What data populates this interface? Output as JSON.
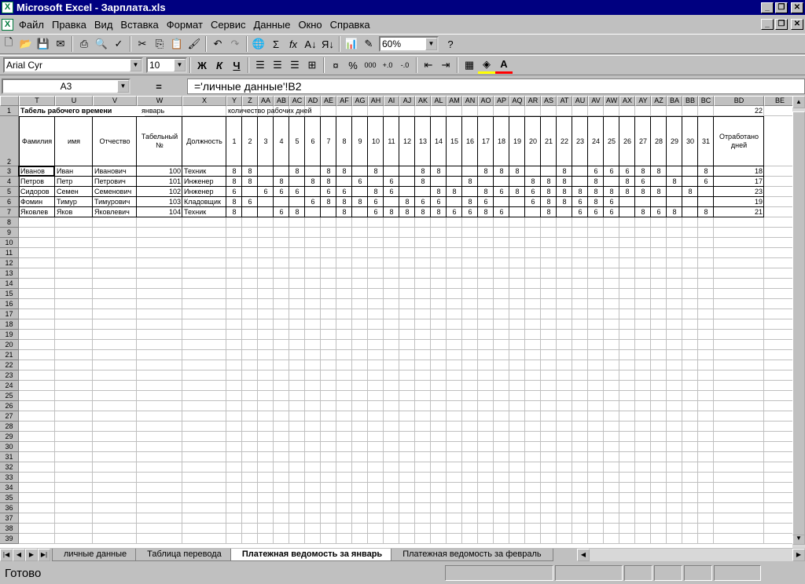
{
  "app_title": "Microsoft Excel - Зарплата.xls",
  "menus": [
    "Файл",
    "Правка",
    "Вид",
    "Вставка",
    "Формат",
    "Сервис",
    "Данные",
    "Окно",
    "Справка"
  ],
  "zoom": "60%",
  "font_name": "Arial Cyr",
  "font_size": "10",
  "name_box": "A3",
  "equals": "=",
  "formula": "='личные данные'!B2",
  "format_buttons": {
    "bold": "Ж",
    "italic": "К",
    "underline": "Ч"
  },
  "columns": [
    {
      "id": "T",
      "w": 46
    },
    {
      "id": "U",
      "w": 48
    },
    {
      "id": "V",
      "w": 56
    },
    {
      "id": "W",
      "w": 58
    },
    {
      "id": "X",
      "w": 56
    },
    {
      "id": "Y",
      "w": 20
    },
    {
      "id": "Z",
      "w": 20
    },
    {
      "id": "AA",
      "w": 20
    },
    {
      "id": "AB",
      "w": 20
    },
    {
      "id": "AC",
      "w": 20
    },
    {
      "id": "AD",
      "w": 20
    },
    {
      "id": "AE",
      "w": 20
    },
    {
      "id": "AF",
      "w": 20
    },
    {
      "id": "AG",
      "w": 20
    },
    {
      "id": "AH",
      "w": 20
    },
    {
      "id": "AI",
      "w": 20
    },
    {
      "id": "AJ",
      "w": 20
    },
    {
      "id": "AK",
      "w": 20
    },
    {
      "id": "AL",
      "w": 20
    },
    {
      "id": "AM",
      "w": 20
    },
    {
      "id": "AN",
      "w": 20
    },
    {
      "id": "AO",
      "w": 20
    },
    {
      "id": "AP",
      "w": 20
    },
    {
      "id": "AQ",
      "w": 20
    },
    {
      "id": "AR",
      "w": 20
    },
    {
      "id": "AS",
      "w": 20
    },
    {
      "id": "AT",
      "w": 20
    },
    {
      "id": "AU",
      "w": 20
    },
    {
      "id": "AV",
      "w": 20
    },
    {
      "id": "AW",
      "w": 20
    },
    {
      "id": "AX",
      "w": 20
    },
    {
      "id": "AY",
      "w": 20
    },
    {
      "id": "AZ",
      "w": 20
    },
    {
      "id": "BA",
      "w": 20
    },
    {
      "id": "BB",
      "w": 20
    },
    {
      "id": "BC",
      "w": 20
    },
    {
      "id": "BD",
      "w": 64
    },
    {
      "id": "BE",
      "w": 40
    }
  ],
  "row1": {
    "title": "Табель рабочего времени",
    "month": "январь",
    "days_label": "количество рабочих дней",
    "days_total": "22"
  },
  "headers": [
    "Фамилия",
    "имя",
    "Отчество",
    "Табельный №",
    "Должность"
  ],
  "day_numbers": [
    "1",
    "2",
    "3",
    "4",
    "5",
    "6",
    "7",
    "8",
    "9",
    "10",
    "11",
    "12",
    "13",
    "14",
    "15",
    "16",
    "17",
    "18",
    "19",
    "20",
    "21",
    "22",
    "23",
    "24",
    "25",
    "26",
    "27",
    "28",
    "29",
    "30",
    "31"
  ],
  "worked_header": "Отработано дней",
  "employees": [
    {
      "last": "Иванов",
      "first": "Иван",
      "middle": "Иванович",
      "num": "100",
      "pos": "Техник",
      "days": [
        "8",
        "8",
        "",
        "",
        "8",
        "",
        "8",
        "8",
        "",
        "8",
        "",
        "",
        "8",
        "8",
        "",
        "",
        "8",
        "8",
        "8",
        "",
        "",
        "8",
        "",
        "6",
        "6",
        "6",
        "8",
        "8",
        "",
        "",
        "8"
      ],
      "total": "18"
    },
    {
      "last": "Петров",
      "first": "Петр",
      "middle": "Петрович",
      "num": "101",
      "pos": "Инженер",
      "days": [
        "8",
        "8",
        "",
        "8",
        "",
        "8",
        "8",
        "",
        "6",
        "",
        "6",
        "",
        "8",
        "",
        "",
        "8",
        "",
        "",
        "",
        "8",
        "8",
        "8",
        "",
        "8",
        "",
        "8",
        "6",
        "",
        "8",
        "",
        "6"
      ],
      "total": "17"
    },
    {
      "last": "Сидоров",
      "first": "Семен",
      "middle": "Семенович",
      "num": "102",
      "pos": "Инженер",
      "days": [
        "6",
        "",
        "6",
        "6",
        "6",
        "",
        "6",
        "6",
        "",
        "8",
        "6",
        "",
        "",
        "8",
        "8",
        "",
        "8",
        "6",
        "8",
        "6",
        "8",
        "8",
        "8",
        "8",
        "8",
        "8",
        "8",
        "8",
        "",
        "8",
        ""
      ],
      "total": "23"
    },
    {
      "last": "Фомин",
      "first": "Тимур",
      "middle": "Тимурович",
      "num": "103",
      "pos": "Кладовщик",
      "days": [
        "8",
        "6",
        "",
        "",
        "",
        "6",
        "8",
        "8",
        "8",
        "6",
        "",
        "8",
        "6",
        "6",
        "",
        "8",
        "6",
        "",
        "",
        "6",
        "8",
        "8",
        "6",
        "8",
        "6",
        "",
        "",
        "",
        "",
        "",
        ""
      ],
      "total": "19"
    },
    {
      "last": "Яковлев",
      "first": "Яков",
      "middle": "Яковлевич",
      "num": "104",
      "pos": "Техник",
      "days": [
        "8",
        "",
        "",
        "6",
        "8",
        "",
        "",
        "8",
        "",
        "6",
        "8",
        "8",
        "8",
        "8",
        "6",
        "6",
        "8",
        "6",
        "",
        "",
        "8",
        "",
        "6",
        "6",
        "6",
        "",
        "8",
        "6",
        "8",
        "",
        "8"
      ],
      "total": "21"
    }
  ],
  "sheet_tabs": [
    "личные данные",
    "Таблица перевода",
    "Платежная ведомость за январь",
    "Платежная ведомость за  февраль"
  ],
  "active_tab": 2,
  "status": "Готово"
}
